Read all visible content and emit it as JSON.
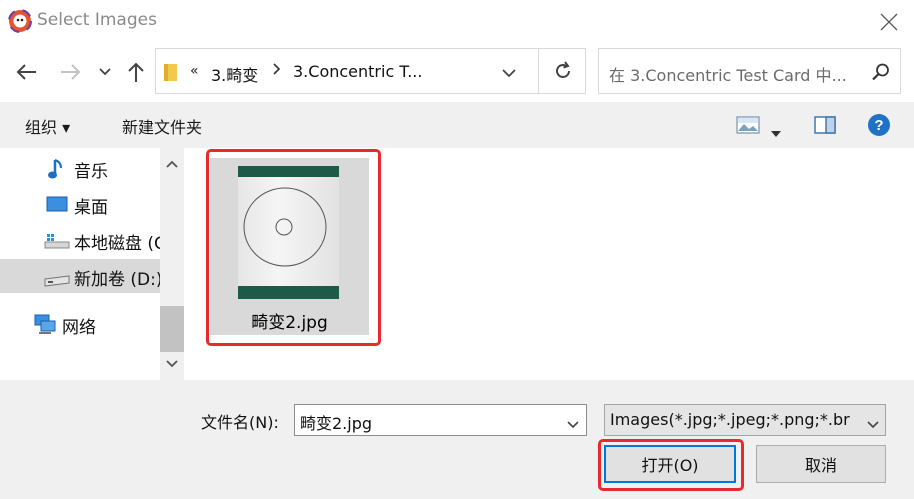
{
  "window": {
    "title": "Select Images"
  },
  "address": {
    "overflow": "«",
    "crumbs": [
      "3.畸变",
      "3.Concentric T..."
    ]
  },
  "search": {
    "placeholder": "在 3.Concentric Test Card 中..."
  },
  "toolbar": {
    "organize_label": "组织 ▾",
    "new_folder_label": "新建文件夹"
  },
  "nav_items": [
    {
      "label": "音乐",
      "icon": "music-note-icon"
    },
    {
      "label": "桌面",
      "icon": "desktop-icon"
    },
    {
      "label": "本地磁盘 (C",
      "icon": "local-disk-icon"
    },
    {
      "label": "新加卷 (D:)",
      "icon": "drive-icon",
      "selected": true
    },
    {
      "label": "网络",
      "icon": "network-icon"
    }
  ],
  "files": [
    {
      "name": "畸变2.jpg",
      "selected": true
    }
  ],
  "bottom": {
    "filename_label": "文件名(N):",
    "filename_value": "畸变2.jpg",
    "filter_value": "Images(*.jpg;*.jpeg;*.png;*.br",
    "open_label": "打开(O)",
    "cancel_label": "取消"
  },
  "colors": {
    "accent": "#0078d7",
    "highlight": "#e8292e",
    "selected_bg": "#d9d9d9",
    "help": "#1e73c8"
  }
}
